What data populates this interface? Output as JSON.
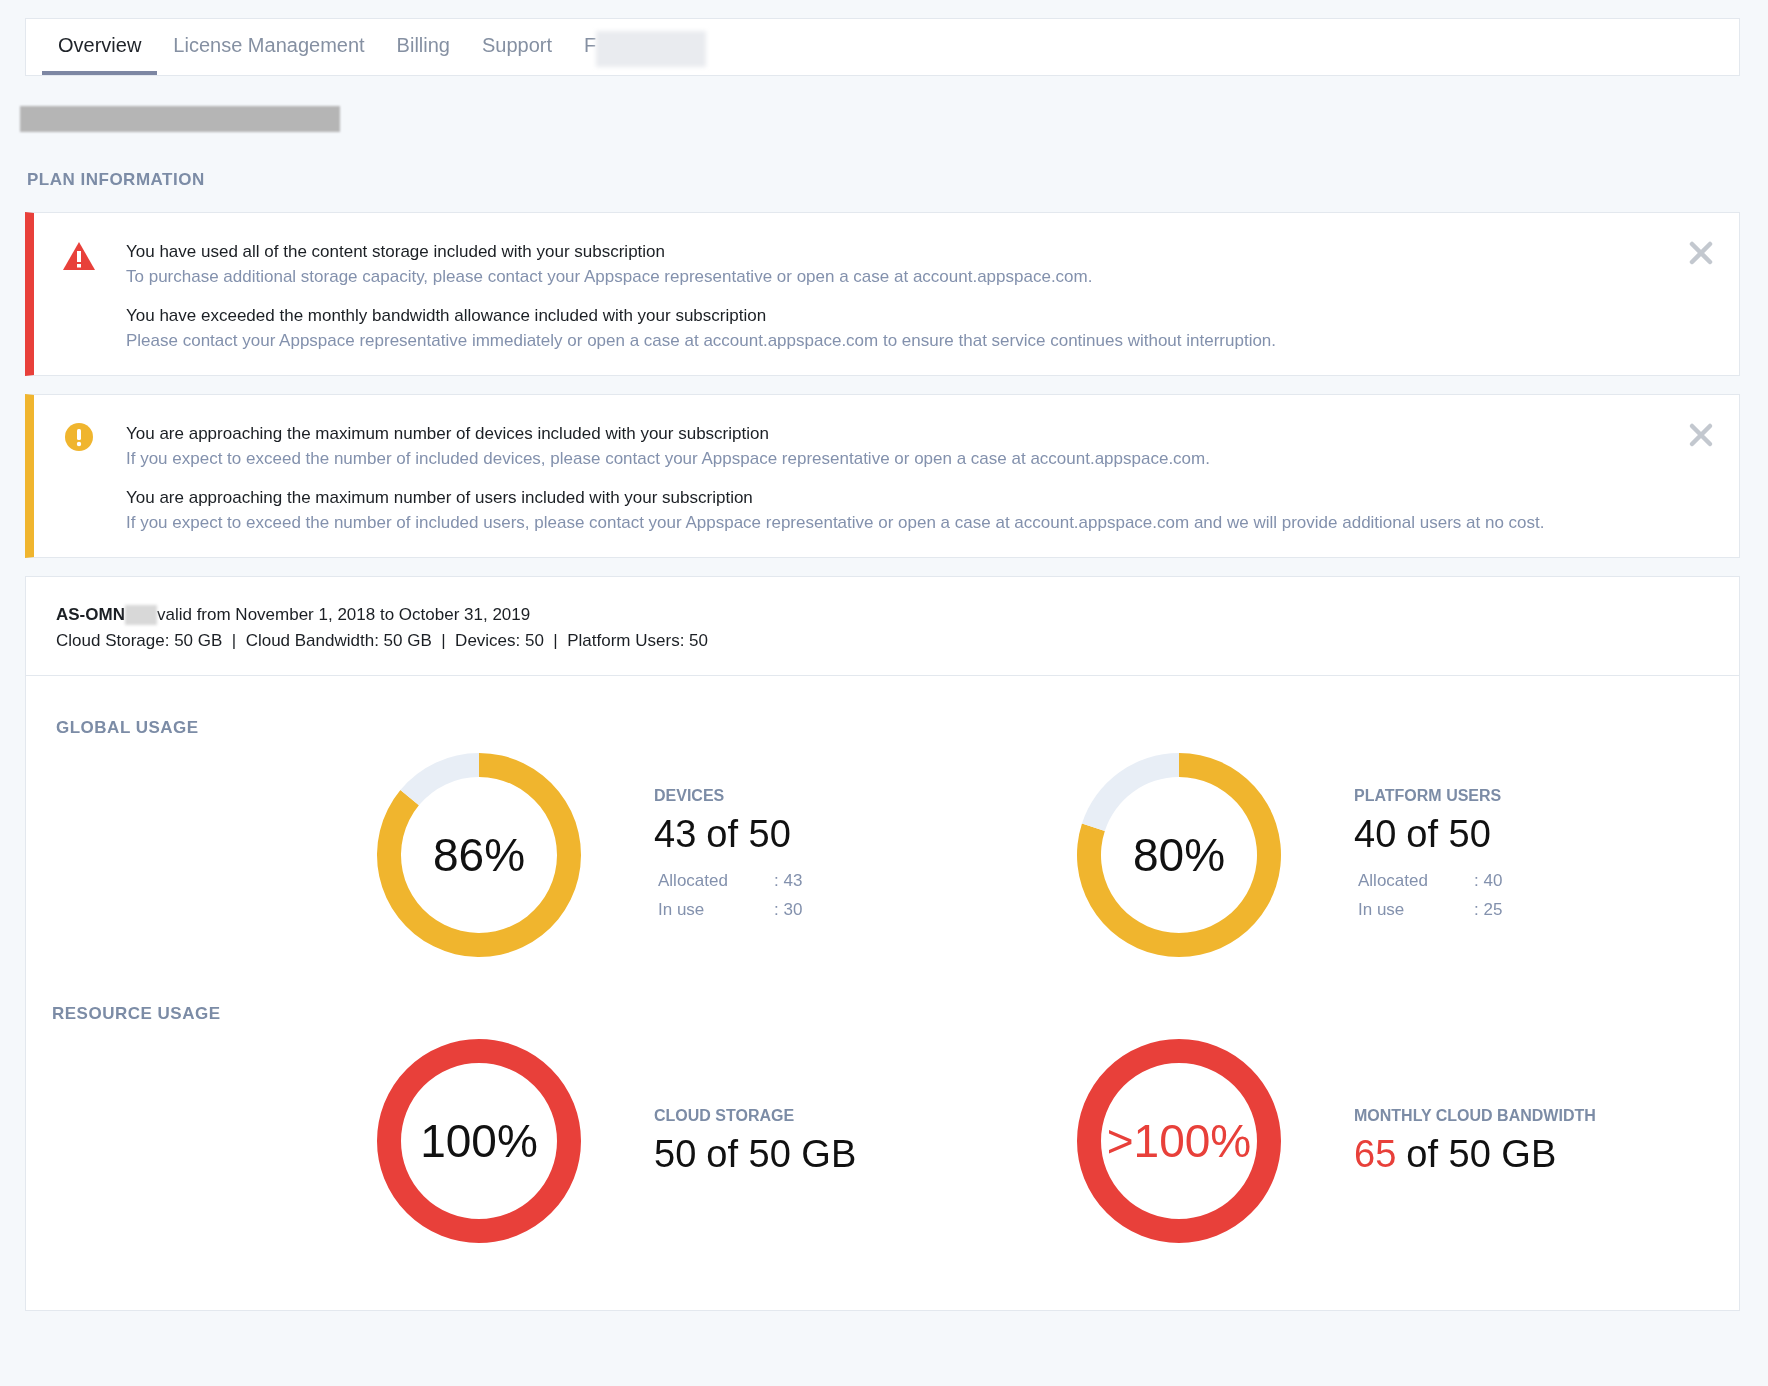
{
  "tabs": [
    {
      "label": "Overview",
      "selected": true
    },
    {
      "label": "License Management",
      "selected": false
    },
    {
      "label": "Billing",
      "selected": false
    },
    {
      "label": "Support",
      "selected": false
    },
    {
      "label": "F",
      "selected": false,
      "redacted": true
    }
  ],
  "section_title": "PLAN INFORMATION",
  "alerts": [
    {
      "color": "#e8403a",
      "kind": "error",
      "messages": [
        {
          "title": "You have used all of the content storage included with your subscription",
          "detail": "To purchase additional storage capacity, please contact your Appspace representative or open a case at account.appspace.com."
        },
        {
          "title": "You have exceeded the monthly bandwidth allowance included with your subscription",
          "detail": "Please contact your Appspace representative immediately or open a case at account.appspace.com to ensure that service continues without interruption."
        }
      ]
    },
    {
      "color": "#f0b52e",
      "kind": "warning",
      "messages": [
        {
          "title": "You are approaching the maximum number of devices included with your subscription",
          "detail": "If you expect to exceed the number of included devices, please contact your Appspace representative or open a case at account.appspace.com."
        },
        {
          "title": "You are approaching the maximum number of users included with your subscription",
          "detail": "If you expect to exceed the number of included users, please contact your Appspace representative or open a case at account.appspace.com and we will provide additional users at no cost."
        }
      ]
    }
  ],
  "plan": {
    "code": "AS-OMN",
    "validity": "valid from November 1, 2018 to October 31, 2019",
    "limits": "Cloud Storage: 50 GB  |  Cloud Bandwidth: 50 GB  |  Devices: 50  |  Platform Users: 50"
  },
  "usage_groups": [
    {
      "title": "GLOBAL USAGE",
      "gauges": [
        {
          "label": "DEVICES",
          "percent": "86%",
          "color": "#f0b52e",
          "chart_data": {
            "type": "donut",
            "values": [
              86,
              14
            ]
          },
          "over": false,
          "used": "43",
          "total": "of 50",
          "details": [
            {
              "name": "Allocated",
              "value": ": 43"
            },
            {
              "name": "In use",
              "value": ": 30"
            }
          ]
        },
        {
          "label": "PLATFORM USERS",
          "percent": "80%",
          "color": "#f0b52e",
          "chart_data": {
            "type": "donut",
            "values": [
              80,
              20
            ]
          },
          "over": false,
          "used": "40",
          "total": "of 50",
          "details": [
            {
              "name": "Allocated",
              "value": ": 40"
            },
            {
              "name": "In use",
              "value": ": 25"
            }
          ]
        }
      ]
    },
    {
      "title": "RESOURCE USAGE",
      "gauges": [
        {
          "label": "CLOUD STORAGE",
          "percent": "100%",
          "color": "#e8403a",
          "over": false,
          "used": "50",
          "total": "of 50 GB"
        },
        {
          "label": "MONTHLY CLOUD BANDWIDTH",
          "percent": ">100%",
          "color": "#e8403a",
          "over": true,
          "used": "65",
          "total": "of 50 GB"
        }
      ]
    }
  ]
}
